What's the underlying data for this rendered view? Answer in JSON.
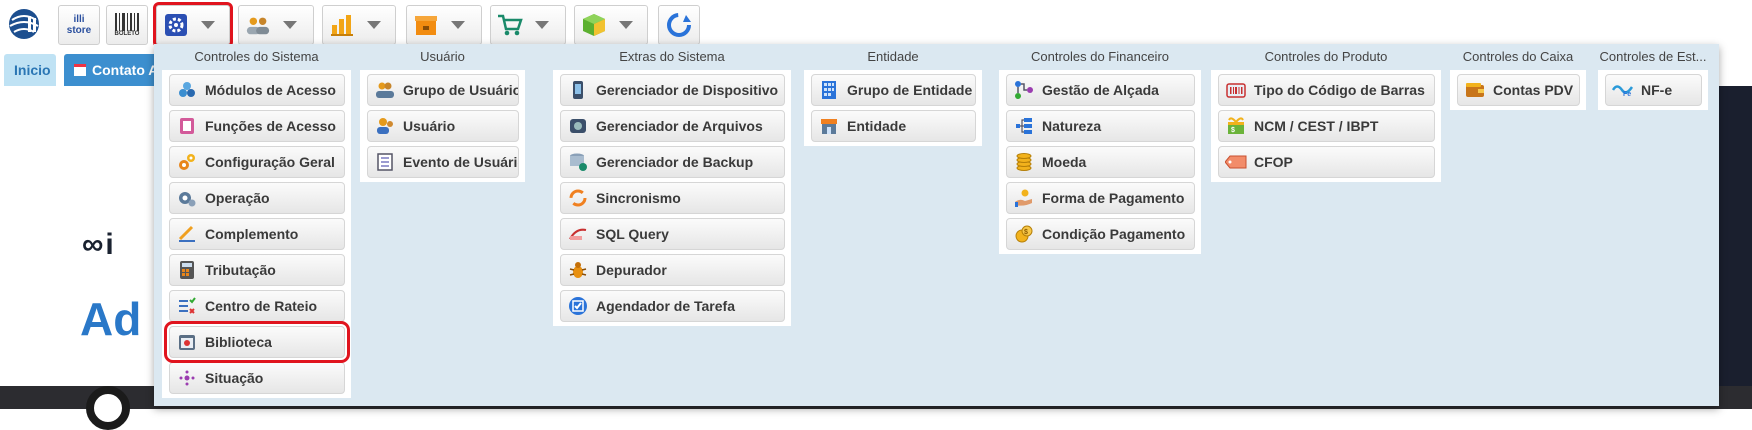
{
  "toolbar": {
    "logo_icon": "globe-logo-icon",
    "store_label": "illi store",
    "boleto_label": "BOLETO",
    "buttons": [
      {
        "icon": "gear-icon",
        "color": "#2b4fb3"
      },
      {
        "icon": "users-icon",
        "color": "#e59a1c"
      },
      {
        "icon": "bar-chart-icon",
        "color": "#f2a516"
      },
      {
        "icon": "box-icon",
        "color": "#f28c10"
      },
      {
        "icon": "cart-icon",
        "color": "#1a8a6a"
      },
      {
        "icon": "package-icon",
        "color": "#5cb030"
      },
      {
        "icon": "refresh-icon",
        "color": "#2a73d9"
      }
    ]
  },
  "tabs": {
    "inicio": "Inicio",
    "contato": "Contato A"
  },
  "menu": {
    "columns": [
      {
        "title": "Controles do Sistema",
        "items": [
          {
            "label": "Módulos de Acesso",
            "icon": "modules-icon"
          },
          {
            "label": "Funções de Acesso",
            "icon": "functions-icon"
          },
          {
            "label": "Configuração Geral",
            "icon": "gears-icon"
          },
          {
            "label": "Operação",
            "icon": "operation-icon"
          },
          {
            "label": "Complemento",
            "icon": "complement-icon"
          },
          {
            "label": "Tributação",
            "icon": "calculator-icon"
          },
          {
            "label": "Centro de Rateio",
            "icon": "checklist-icon"
          },
          {
            "label": "Biblioteca",
            "icon": "library-icon"
          },
          {
            "label": "Situação",
            "icon": "status-icon"
          }
        ]
      },
      {
        "title": "Usuário",
        "items": [
          {
            "label": "Grupo de Usuário",
            "icon": "user-group-icon"
          },
          {
            "label": "Usuário",
            "icon": "user-icon"
          },
          {
            "label": "Evento de Usuário",
            "icon": "user-event-icon"
          }
        ]
      },
      {
        "title": "Extras do Sistema",
        "items": [
          {
            "label": "Gerenciador de Dispositivo",
            "icon": "device-icon"
          },
          {
            "label": "Gerenciador de Arquivos",
            "icon": "drive-icon"
          },
          {
            "label": "Gerenciador de Backup",
            "icon": "backup-icon"
          },
          {
            "label": "Sincronismo",
            "icon": "sync-icon"
          },
          {
            "label": "SQL Query",
            "icon": "mysql-icon"
          },
          {
            "label": "Depurador",
            "icon": "bug-icon"
          },
          {
            "label": "Agendador de Tarefa",
            "icon": "task-scheduler-icon"
          }
        ]
      },
      {
        "title": "Entidade",
        "items": [
          {
            "label": "Grupo de Entidade",
            "icon": "entity-group-icon"
          },
          {
            "label": "Entidade",
            "icon": "store-icon"
          }
        ]
      },
      {
        "title": "Controles do Financeiro",
        "items": [
          {
            "label": "Gestão de Alçada",
            "icon": "hierarchy-icon"
          },
          {
            "label": "Natureza",
            "icon": "nature-icon"
          },
          {
            "label": "Moeda",
            "icon": "coins-icon"
          },
          {
            "label": "Forma de Pagamento",
            "icon": "payment-hand-icon"
          },
          {
            "label": "Condição Pagamento",
            "icon": "payment-condition-icon"
          }
        ]
      },
      {
        "title": "Controles do Produto",
        "items": [
          {
            "label": "Tipo do Código de Barras",
            "icon": "barcode-icon"
          },
          {
            "label": "NCM / CEST / IBPT",
            "icon": "ncm-icon"
          },
          {
            "label": "CFOP",
            "icon": "tag-icon"
          }
        ]
      },
      {
        "title": "Controles do Caixa",
        "items": [
          {
            "label": "Contas PDV",
            "icon": "wallet-icon"
          }
        ]
      },
      {
        "title": "Controles de Est...",
        "items": [
          {
            "label": "NF-e",
            "icon": "nfe-icon"
          }
        ]
      }
    ]
  },
  "background": {
    "logo_text": "∞i",
    "heading_text": "Ad"
  }
}
